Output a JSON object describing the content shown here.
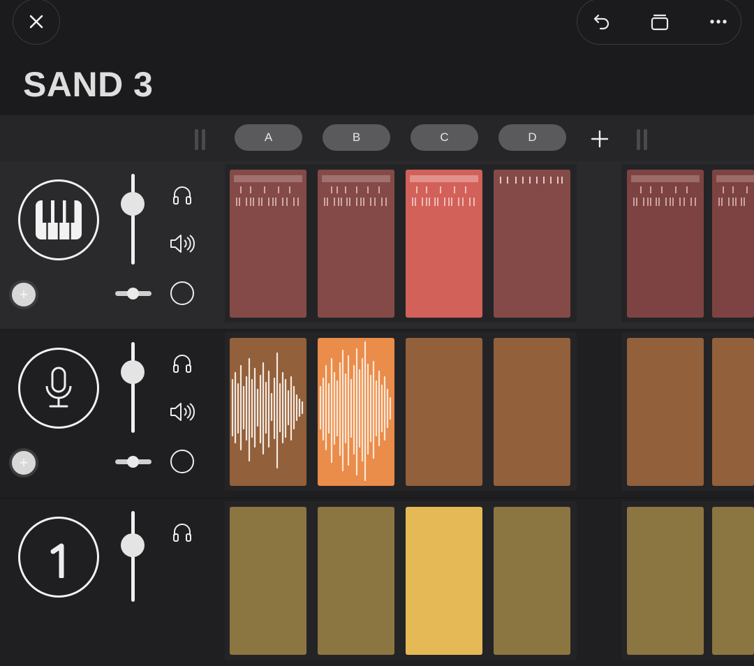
{
  "header": {
    "title": "SAND 3",
    "close_icon": "close-icon",
    "tools": [
      "undo-icon",
      "duplicate-icon",
      "more-icon"
    ]
  },
  "scenes": {
    "labels": [
      "A",
      "B",
      "C",
      "D"
    ],
    "add_icon": "plus-icon"
  },
  "tracks": [
    {
      "instrument": "piano-icon",
      "controls": [
        "headphones-icon",
        "speaker-icon",
        "record-ring-icon"
      ],
      "volume": 0.68,
      "pan": 0.5,
      "color": "#844a47",
      "active_color": "#d2615a",
      "active_clip": 2,
      "clip_type": "notes"
    },
    {
      "instrument": "microphone-icon",
      "controls": [
        "headphones-icon",
        "speaker-icon",
        "record-ring-icon"
      ],
      "volume": 0.68,
      "pan": 0.5,
      "color": "#92603b",
      "active_color": "#ea8c4a",
      "active_clip": 1,
      "clip_type": "audio"
    },
    {
      "instrument": "sampler-1-icon",
      "controls": [
        "headphones-icon"
      ],
      "color": "#8b7541",
      "active_color": "#e6b957",
      "active_clip": 2,
      "clip_type": "empty"
    }
  ]
}
